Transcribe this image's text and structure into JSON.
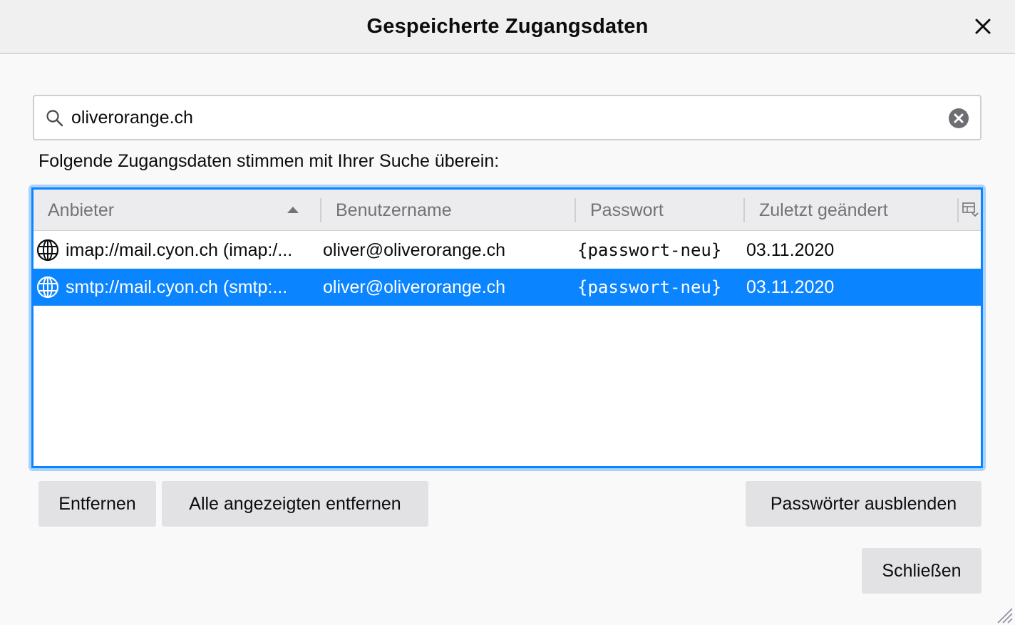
{
  "window": {
    "title": "Gespeicherte Zugangsdaten",
    "close_icon": "close-icon"
  },
  "search": {
    "value": "oliverorange.ch",
    "icon": "search-icon",
    "clear_icon": "clear-circle-icon"
  },
  "match_label": "Folgende Zugangsdaten stimmen mit Ihrer Suche überein:",
  "table": {
    "columns": [
      "Anbieter",
      "Benutzername",
      "Passwort",
      "Zuletzt geändert"
    ],
    "sort_column": "Anbieter",
    "sort_direction": "ascending",
    "rows": [
      {
        "provider": "imap://mail.cyon.ch (imap:/...",
        "username": "oliver@oliverorange.ch",
        "password": "{passwort-neu}",
        "changed": "03.11.2020",
        "selected": false
      },
      {
        "provider": "smtp://mail.cyon.ch (smtp:...",
        "username": "oliver@oliverorange.ch",
        "password": "{passwort-neu}",
        "changed": "03.11.2020",
        "selected": true
      }
    ]
  },
  "buttons": {
    "remove": "Entfernen",
    "remove_all": "Alle angezeigten entfernen",
    "hide_passwords": "Passwörter ausblenden",
    "close": "Schließen"
  },
  "colors": {
    "accent": "#0a84ff",
    "focus_ring": "#a9d3fd",
    "button_bg": "#e2e2e4"
  }
}
